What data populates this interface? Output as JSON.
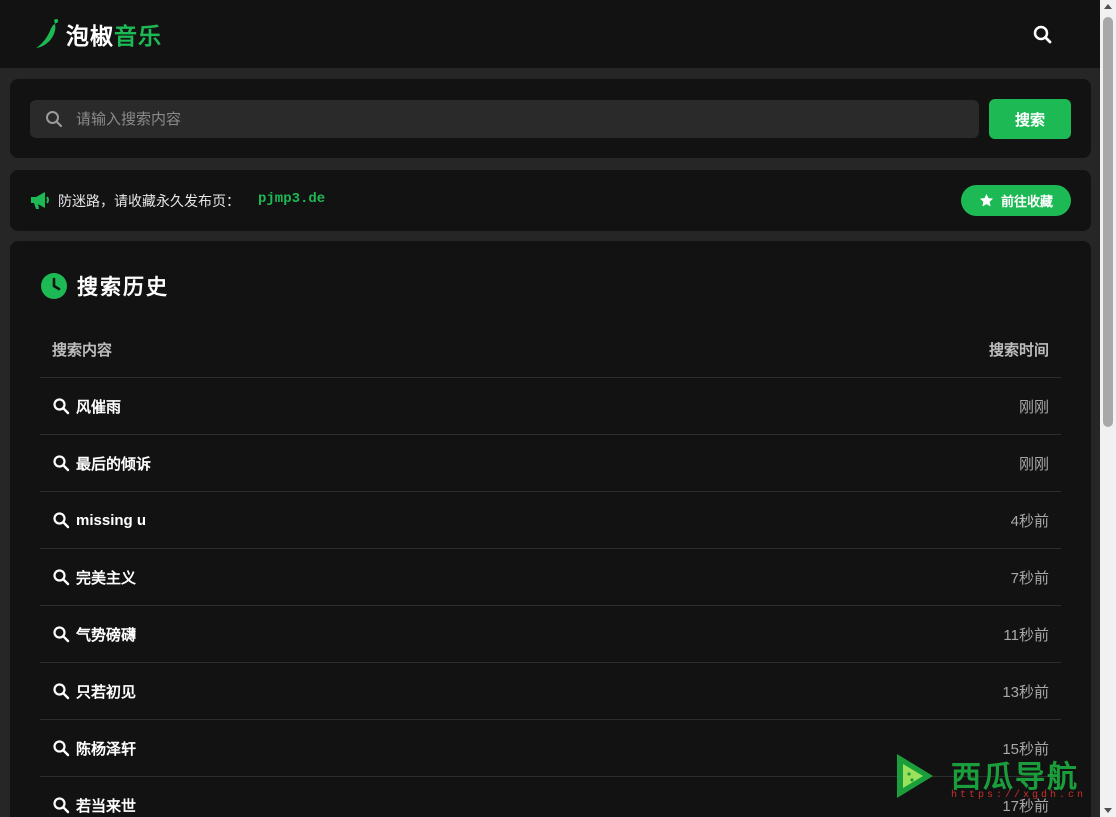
{
  "header": {
    "logo_part1": "泡椒",
    "logo_part2": "音乐",
    "search_icon": "search-icon"
  },
  "search": {
    "placeholder": "请输入搜索内容",
    "value": "",
    "button_label": "搜索"
  },
  "notice": {
    "icon": "megaphone-icon",
    "text": "防迷路，请收藏永久发布页：",
    "link": "pjmp3.de",
    "fav_button_label": "前往收藏"
  },
  "history": {
    "title": "搜索历史",
    "col_query": "搜索内容",
    "col_time": "搜索时间",
    "rows": [
      {
        "query": "风催雨",
        "time": "刚刚"
      },
      {
        "query": "最后的倾诉",
        "time": "刚刚"
      },
      {
        "query": "missing u",
        "time": "4秒前"
      },
      {
        "query": "完美主义",
        "time": "7秒前"
      },
      {
        "query": "气势磅礴",
        "time": "11秒前"
      },
      {
        "query": "只若初见",
        "time": "13秒前"
      },
      {
        "query": "陈杨泽轩",
        "time": "15秒前"
      },
      {
        "query": "若当来世",
        "time": "17秒前"
      }
    ]
  },
  "watermark": {
    "title": "西瓜导航",
    "subtitle": "https://xgdh.cn"
  },
  "colors": {
    "accent": "#1db954",
    "background": "#262626",
    "card": "#121212"
  }
}
